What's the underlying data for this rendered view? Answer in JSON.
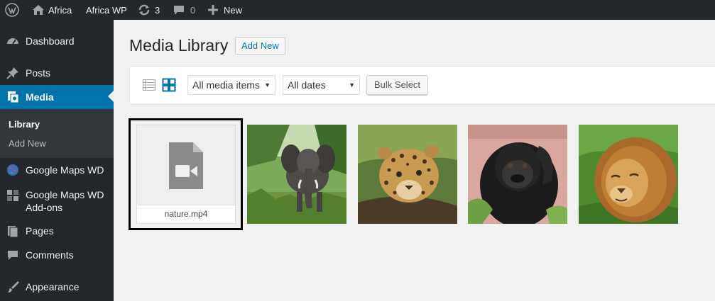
{
  "adminbar": {
    "site_name": "Africa",
    "site_link": "Africa WP",
    "updates_count": "3",
    "comments_count": "0",
    "new_label": "New",
    "icons": [
      "wordpress-logo-icon",
      "home-icon",
      "refresh-icon",
      "comment-icon",
      "plus-icon"
    ]
  },
  "sidebar": {
    "items": [
      {
        "label": "Dashboard",
        "icon": "dashboard-icon"
      },
      {
        "label": "Posts",
        "icon": "pushpin-icon"
      },
      {
        "label": "Media",
        "icon": "media-icon",
        "active": true
      },
      {
        "label": "Google Maps WD",
        "icon": "globe-icon"
      },
      {
        "label": "Google Maps WD Add-ons",
        "icon": "google-maps-addon-icon"
      },
      {
        "label": "Pages",
        "icon": "pages-icon"
      },
      {
        "label": "Comments",
        "icon": "comment-icon"
      },
      {
        "label": "Appearance",
        "icon": "paintbrush-icon"
      }
    ],
    "submenu": [
      {
        "label": "Library",
        "current": true
      },
      {
        "label": "Add New"
      }
    ]
  },
  "main": {
    "title": "Media Library",
    "add_new_label": "Add New",
    "toolbar": {
      "list_view_icon": "list-view-icon",
      "grid_view_icon": "grid-view-icon",
      "media_filter": "All media items",
      "date_filter": "All dates",
      "bulk_select_label": "Bulk Select"
    },
    "items": [
      {
        "type": "video",
        "filename": "nature.mp4",
        "icon": "video-file-icon",
        "selected": true
      },
      {
        "type": "image",
        "subject": "elephant"
      },
      {
        "type": "image",
        "subject": "leopard"
      },
      {
        "type": "image",
        "subject": "gorilla"
      },
      {
        "type": "image",
        "subject": "lion"
      }
    ]
  },
  "colors": {
    "adminbar_bg": "#23282d",
    "sidebar_bg": "#23282d",
    "accent": "#0073aa",
    "content_bg": "#f1f1f1"
  }
}
